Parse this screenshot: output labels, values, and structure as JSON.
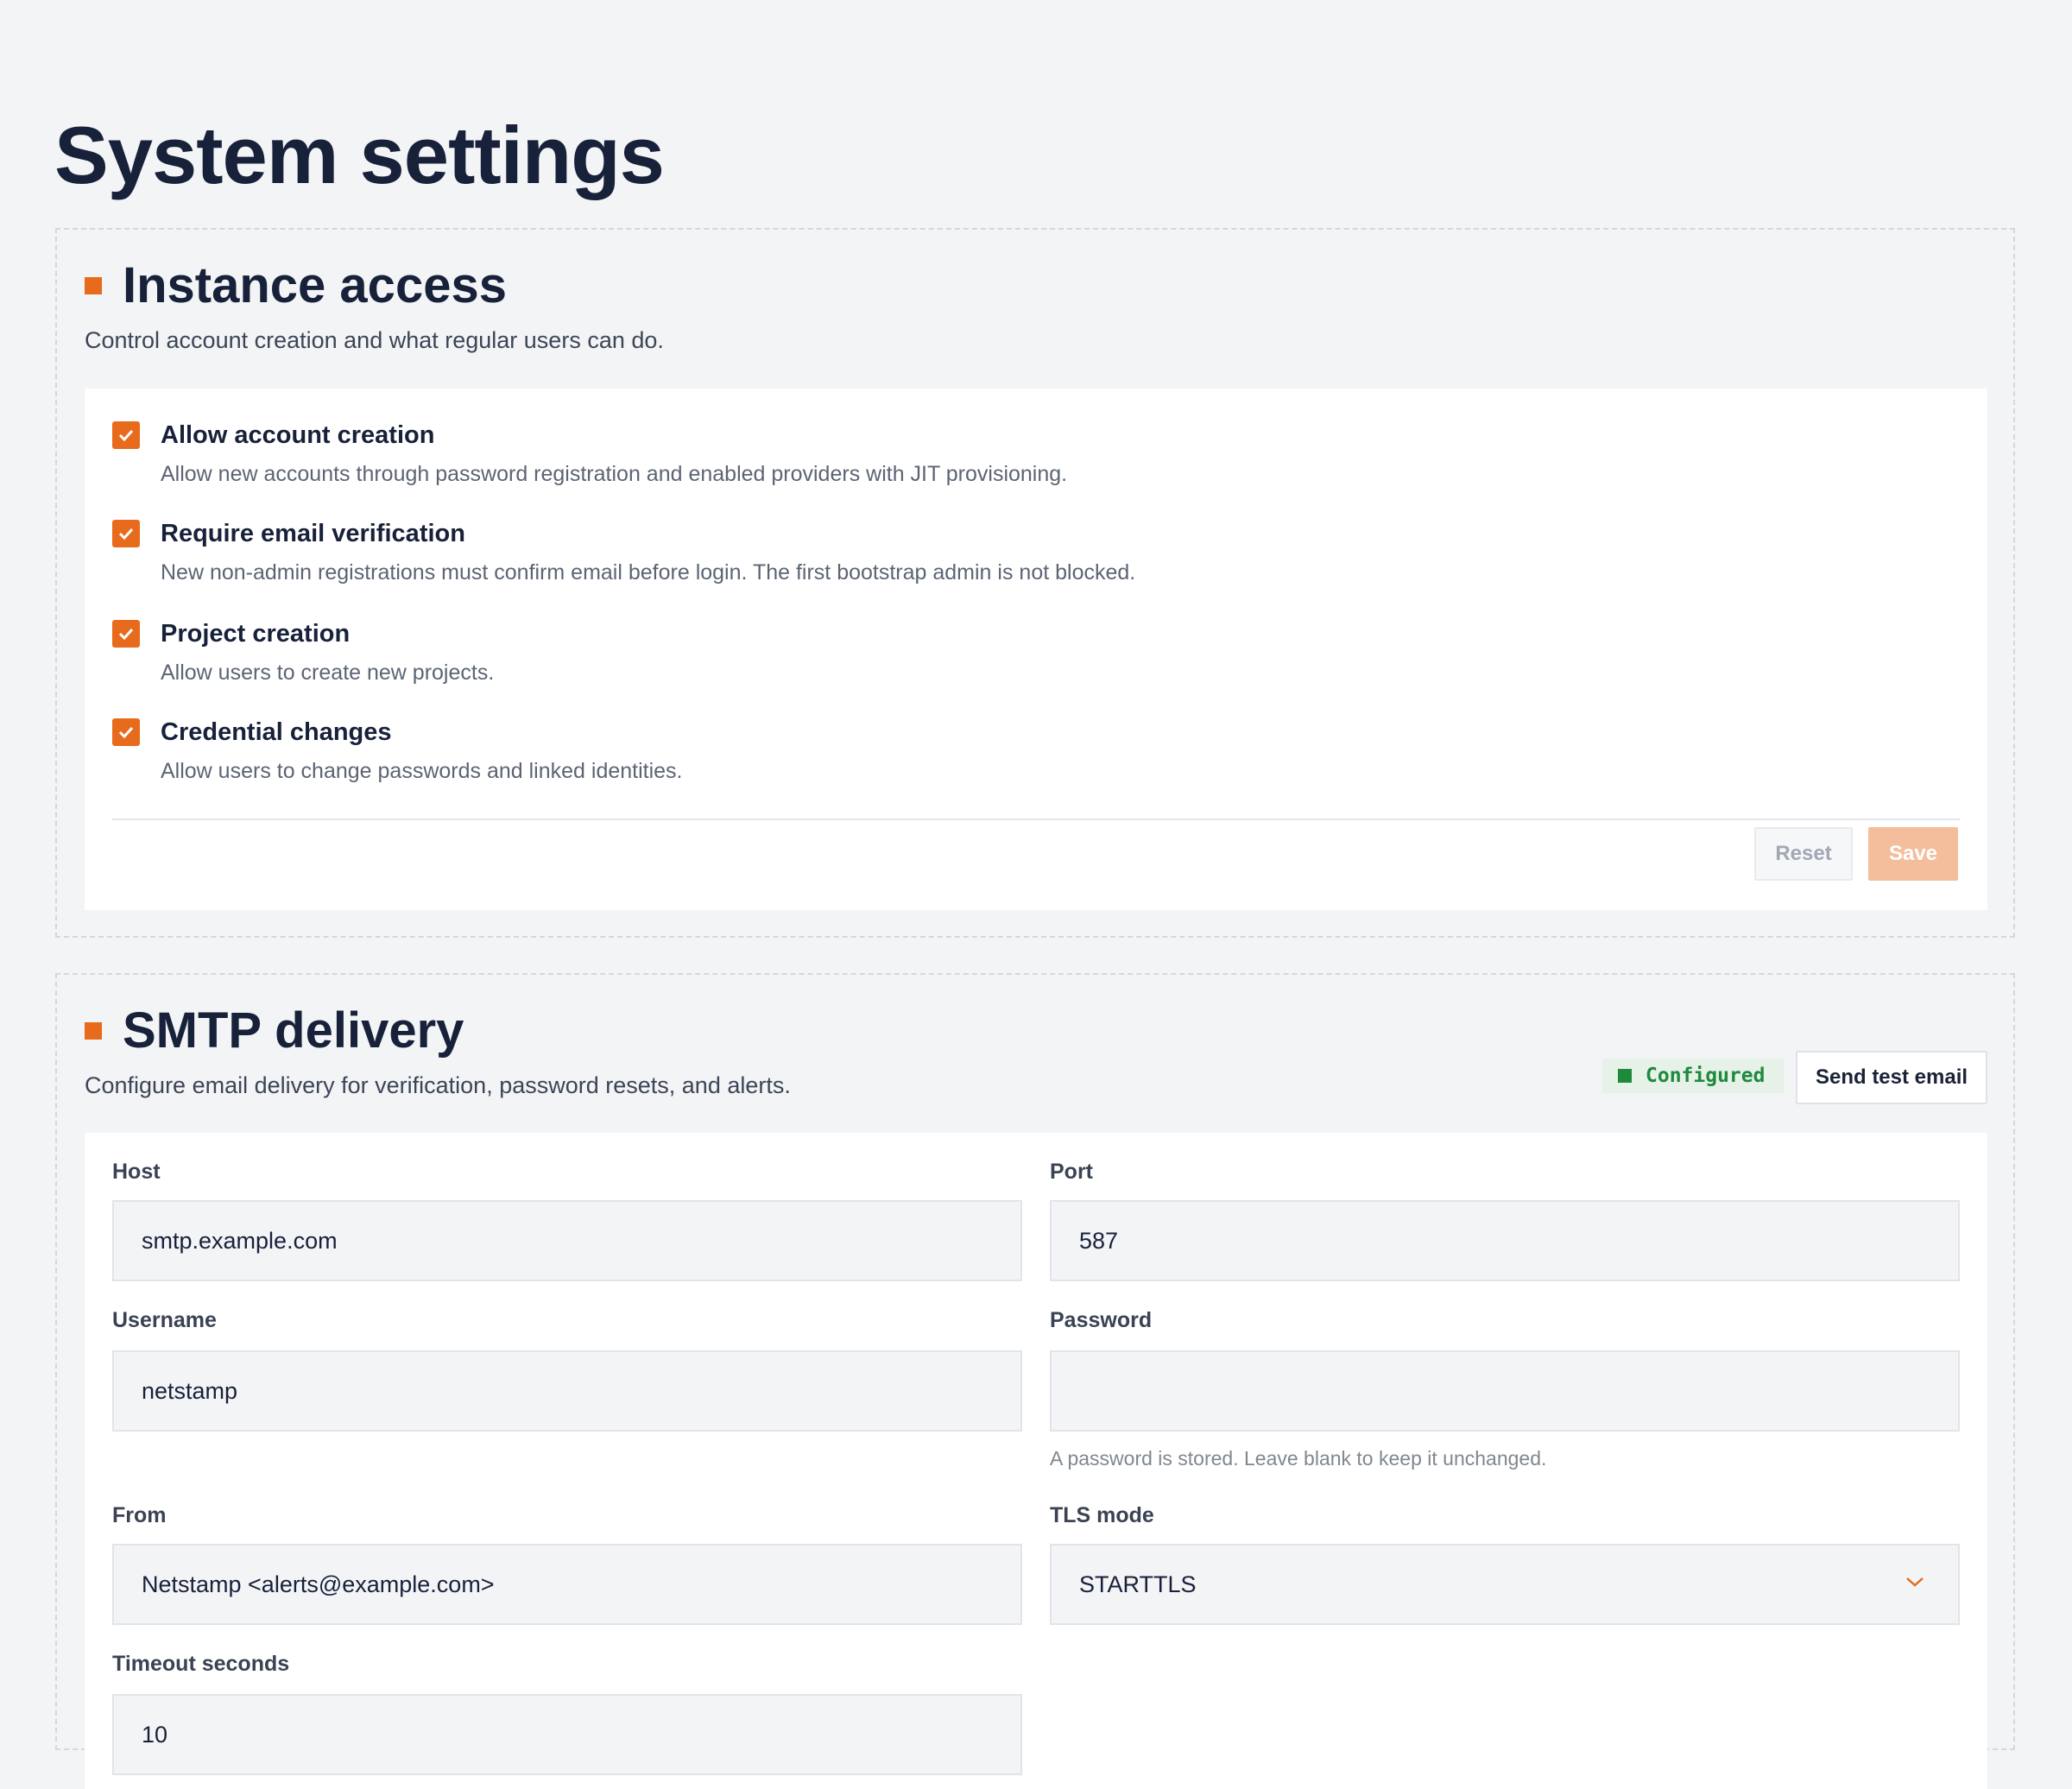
{
  "page": {
    "title": "System settings"
  },
  "instance_access": {
    "title": "Instance access",
    "description": "Control account creation and what regular users can do.",
    "options": [
      {
        "title": "Allow account creation",
        "description": "Allow new accounts through password registration and enabled providers with JIT provisioning.",
        "checked": true
      },
      {
        "title": "Require email verification",
        "description": "New non-admin registrations must confirm email before login. The first bootstrap admin is not blocked.",
        "checked": true
      },
      {
        "title": "Project creation",
        "description": "Allow users to create new projects.",
        "checked": true
      },
      {
        "title": "Credential changes",
        "description": "Allow users to change passwords and linked identities.",
        "checked": true
      }
    ],
    "reset_label": "Reset",
    "save_label": "Save"
  },
  "smtp": {
    "title": "SMTP delivery",
    "description": "Configure email delivery for verification, password resets, and alerts.",
    "status_badge": "Configured",
    "test_button": "Send test email",
    "fields": {
      "host": {
        "label": "Host",
        "value": "smtp.example.com"
      },
      "port": {
        "label": "Port",
        "value": "587"
      },
      "username": {
        "label": "Username",
        "value": "netstamp"
      },
      "password": {
        "label": "Password",
        "value": "",
        "hint": "A password is stored. Leave blank to keep it unchanged."
      },
      "from": {
        "label": "From",
        "value": "Netstamp <alerts@example.com>"
      },
      "tls_mode": {
        "label": "TLS mode",
        "value": "STARTTLS"
      },
      "timeout": {
        "label": "Timeout seconds",
        "value": "10"
      }
    }
  },
  "colors": {
    "accent": "#e86a1c",
    "success": "#1e8a3c",
    "heading": "#18213a"
  },
  "icons": {
    "checkbox": "check-icon",
    "select": "chevron-down-icon",
    "status": "status-dot-icon"
  }
}
